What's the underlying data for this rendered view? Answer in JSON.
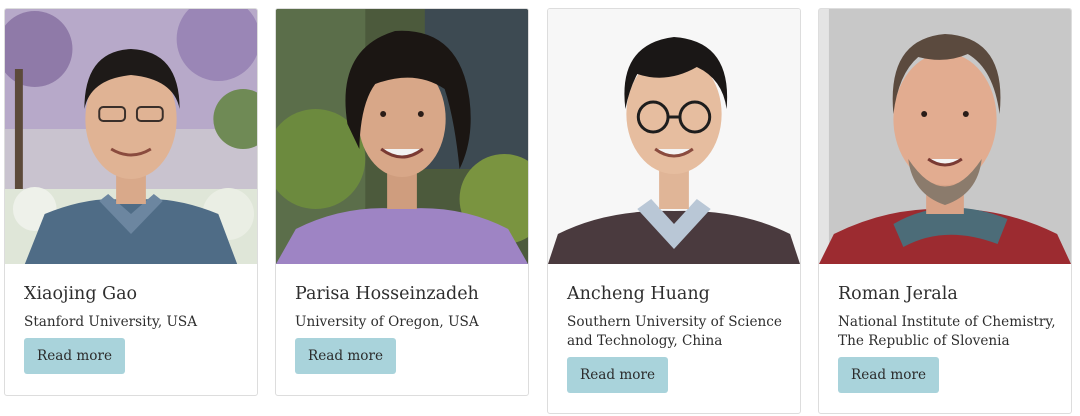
{
  "people": [
    {
      "name": "Xiaojing Gao",
      "affiliation_lines": [
        "Stanford University, USA"
      ],
      "button_label": "Read more"
    },
    {
      "name": "Parisa Hosseinzadeh",
      "affiliation_lines": [
        "University of Oregon, USA"
      ],
      "button_label": "Read more"
    },
    {
      "name": "Ancheng Huang",
      "affiliation_lines": [
        "Southern University of Science",
        "and Technology, China"
      ],
      "button_label": "Read more"
    },
    {
      "name": "Roman Jerala",
      "affiliation_lines": [
        "National Institute of Chemistry,",
        "The Republic of Slovenia"
      ],
      "button_label": "Read more"
    }
  ],
  "colors": {
    "button_background": "#a9d3db",
    "card_border": "#dddddd",
    "text": "#2e2e2e"
  }
}
